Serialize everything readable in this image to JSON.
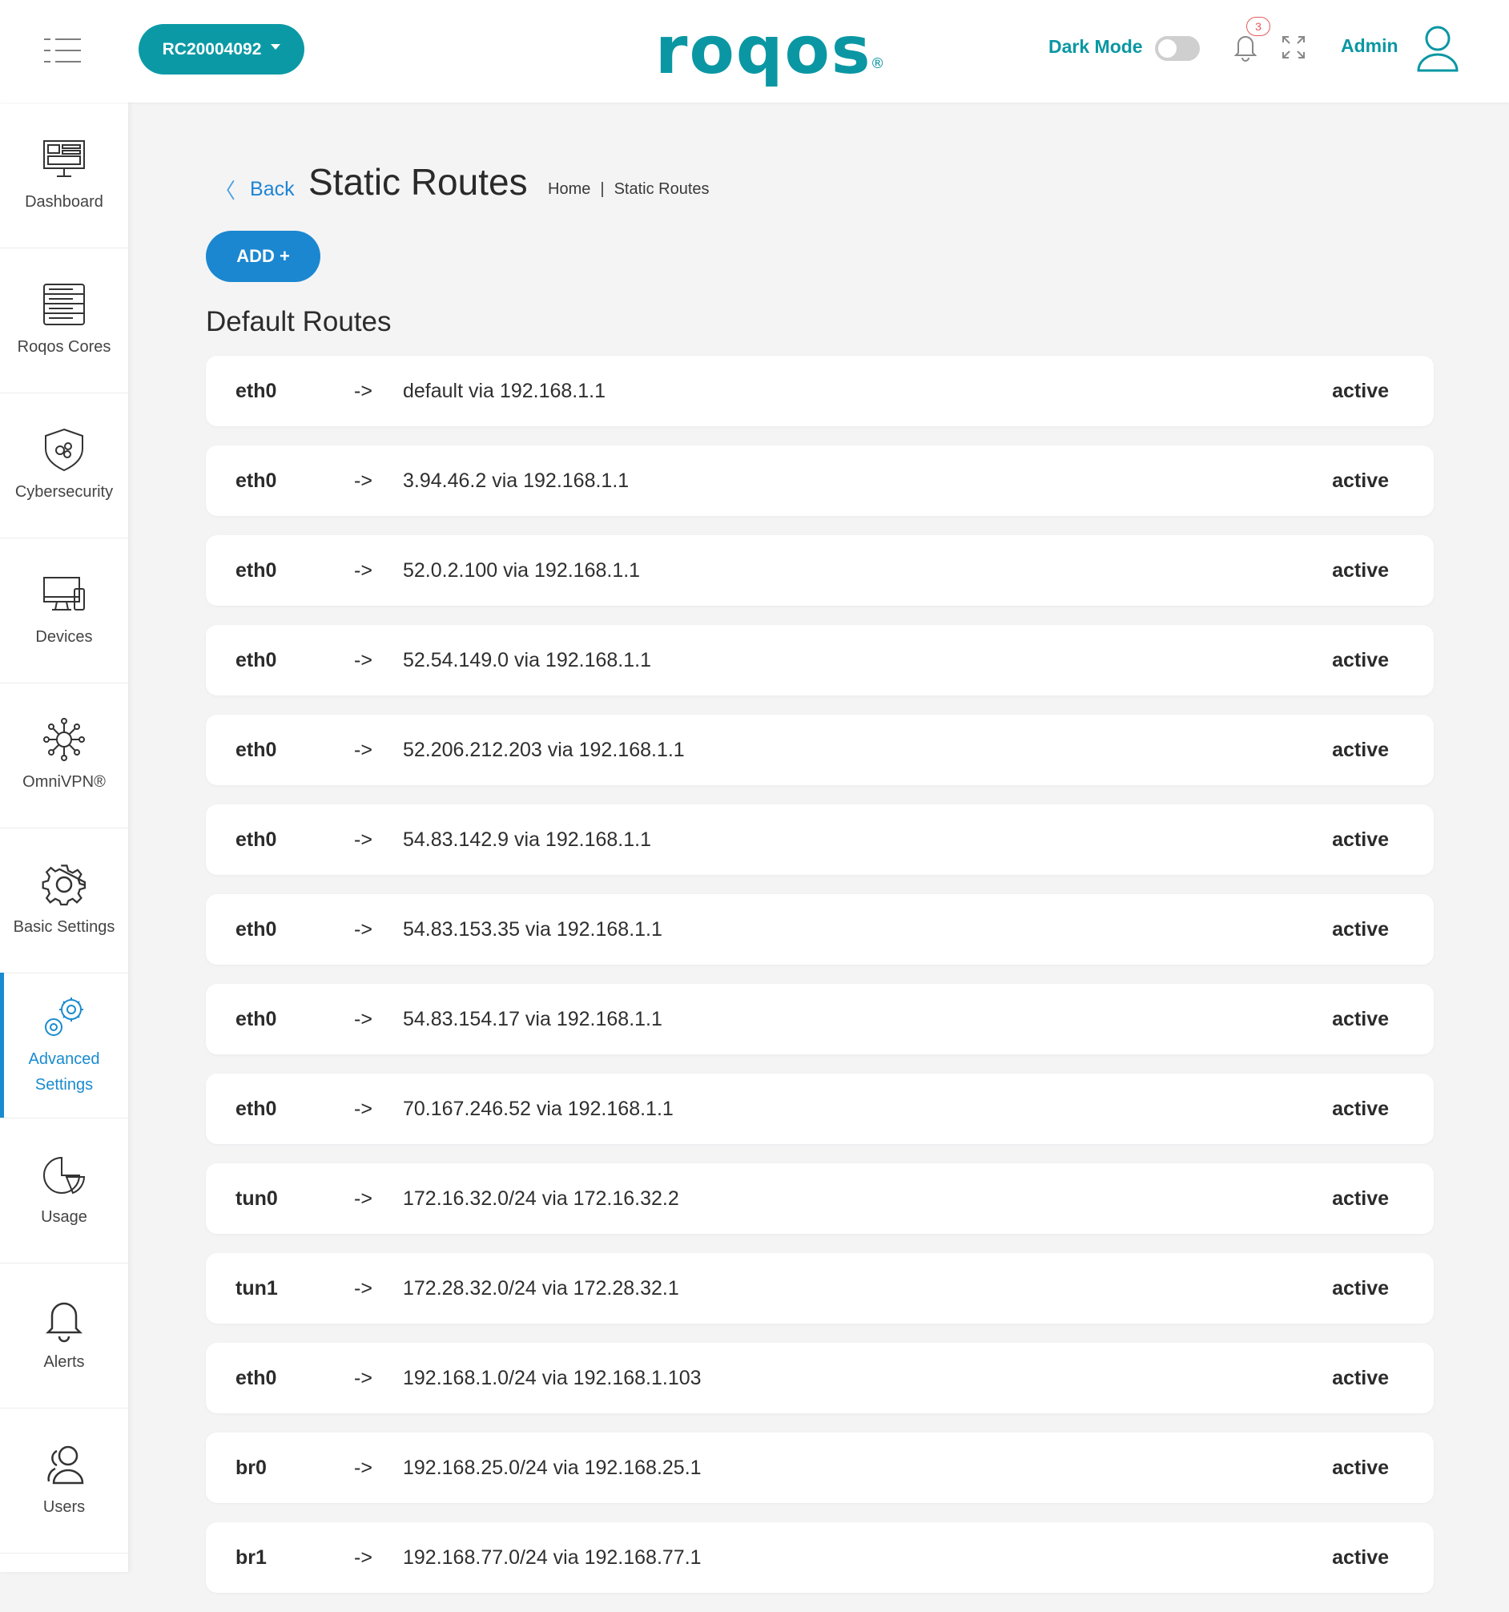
{
  "header": {
    "device_selector": "RC20004092",
    "logo_text": "roqos",
    "logo_mark": "®",
    "dark_mode_label": "Dark Mode",
    "notification_count": "3",
    "user_label": "Admin"
  },
  "sidebar": {
    "items": [
      {
        "label": "Dashboard",
        "icon": "dashboard-icon"
      },
      {
        "label": "Roqos Cores",
        "icon": "server-rack-icon"
      },
      {
        "label": "Cybersecurity",
        "icon": "shield-icon"
      },
      {
        "label": "Devices",
        "icon": "devices-icon"
      },
      {
        "label": "OmniVPN®",
        "icon": "network-hub-icon"
      },
      {
        "label": "Basic Settings",
        "icon": "gear-icon"
      },
      {
        "label": "Advanced\nSettings",
        "icon": "gears-icon",
        "active": true
      },
      {
        "label": "Usage",
        "icon": "pie-chart-icon"
      },
      {
        "label": "Alerts",
        "icon": "bell-icon"
      },
      {
        "label": "Users",
        "icon": "users-icon"
      }
    ]
  },
  "page": {
    "back_label": "Back",
    "title": "Static Routes",
    "breadcrumb": [
      "Home",
      "|",
      "Static Routes"
    ],
    "add_button": "ADD +",
    "section_title": "Default Routes"
  },
  "routes": [
    {
      "iface": "eth0",
      "arrow": "->",
      "dest": "default via 192.168.1.1",
      "status": "active"
    },
    {
      "iface": "eth0",
      "arrow": "->",
      "dest": "3.94.46.2 via 192.168.1.1",
      "status": "active"
    },
    {
      "iface": "eth0",
      "arrow": "->",
      "dest": "52.0.2.100 via 192.168.1.1",
      "status": "active"
    },
    {
      "iface": "eth0",
      "arrow": "->",
      "dest": "52.54.149.0 via 192.168.1.1",
      "status": "active"
    },
    {
      "iface": "eth0",
      "arrow": "->",
      "dest": "52.206.212.203 via 192.168.1.1",
      "status": "active"
    },
    {
      "iface": "eth0",
      "arrow": "->",
      "dest": "54.83.142.9 via 192.168.1.1",
      "status": "active"
    },
    {
      "iface": "eth0",
      "arrow": "->",
      "dest": "54.83.153.35 via 192.168.1.1",
      "status": "active"
    },
    {
      "iface": "eth0",
      "arrow": "->",
      "dest": "54.83.154.17 via 192.168.1.1",
      "status": "active"
    },
    {
      "iface": "eth0",
      "arrow": "->",
      "dest": "70.167.246.52 via 192.168.1.1",
      "status": "active"
    },
    {
      "iface": "tun0",
      "arrow": "->",
      "dest": "172.16.32.0/24 via 172.16.32.2",
      "status": "active"
    },
    {
      "iface": "tun1",
      "arrow": "->",
      "dest": "172.28.32.0/24 via 172.28.32.1",
      "status": "active"
    },
    {
      "iface": "eth0",
      "arrow": "->",
      "dest": "192.168.1.0/24 via 192.168.1.103",
      "status": "active"
    },
    {
      "iface": "br0",
      "arrow": "->",
      "dest": "192.168.25.0/24 via 192.168.25.1",
      "status": "active"
    },
    {
      "iface": "br1",
      "arrow": "->",
      "dest": "192.168.77.0/24 via 192.168.77.1",
      "status": "active"
    }
  ],
  "colors": {
    "brand": "#0a97a3",
    "primary": "#1b87d0",
    "background": "#f4f4f5"
  }
}
